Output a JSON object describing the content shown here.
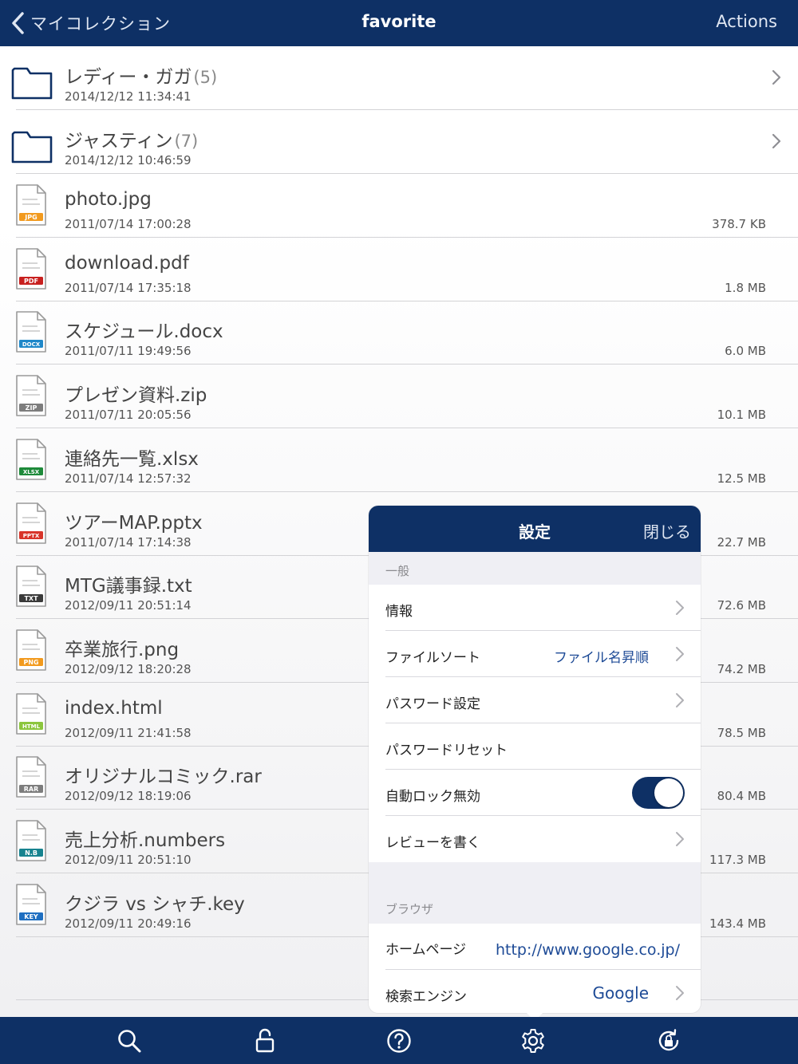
{
  "navbar": {
    "back_label": "マイコレクション",
    "title": "favorite",
    "actions_label": "Actions"
  },
  "folders": [
    {
      "name": "レディー・ガガ",
      "count": "(5)",
      "date": "2014/12/12 11:34:41"
    },
    {
      "name": "ジャスティン",
      "count": "(7)",
      "date": "2014/12/12 10:46:59"
    }
  ],
  "files": [
    {
      "name": "photo.jpg",
      "date": "2011/07/14 17:00:28",
      "size": "378.7 KB",
      "badge": "JPG",
      "color": "#f29a1e",
      "icon": "image-file-icon"
    },
    {
      "name": "download.pdf",
      "date": "2011/07/14 17:35:18",
      "size": "1.8 MB",
      "badge": "PDF",
      "color": "#c8201f",
      "icon": "pdf-file-icon"
    },
    {
      "name": "スケジュール.docx",
      "date": "2011/07/11 19:49:56",
      "size": "6.0 MB",
      "badge": "DOCX",
      "color": "#1f88c9",
      "icon": "word-file-icon"
    },
    {
      "name": "プレゼン資料.zip",
      "date": "2011/07/11 20:05:56",
      "size": "10.1 MB",
      "badge": "ZIP",
      "color": "#7d7d7d",
      "icon": "zip-file-icon"
    },
    {
      "name": "連絡先一覧.xlsx",
      "date": "2011/07/14 12:57:32",
      "size": "12.5 MB",
      "badge": "XLSX",
      "color": "#1e8a3a",
      "icon": "excel-file-icon"
    },
    {
      "name": "ツアーMAP.pptx",
      "date": "2011/07/14 17:14:38",
      "size": "22.7 MB",
      "badge": "PPTX",
      "color": "#d8352a",
      "icon": "powerpoint-file-icon"
    },
    {
      "name": "MTG議事録.txt",
      "date": "2012/09/11 20:51:14",
      "size": "72.6 MB",
      "badge": "TXT",
      "color": "#3a3a3a",
      "icon": "text-file-icon"
    },
    {
      "name": "卒業旅行.png",
      "date": "2012/09/12 18:20:28",
      "size": "74.2 MB",
      "badge": "PNG",
      "color": "#f29a1e",
      "icon": "image-file-icon"
    },
    {
      "name": "index.html",
      "date": "2012/09/11 21:41:58",
      "size": "78.5 MB",
      "badge": "HTML",
      "color": "#8cc63e",
      "icon": "html-file-icon"
    },
    {
      "name": "オリジナルコミック.rar",
      "date": "2012/09/12 18:19:06",
      "size": "80.4 MB",
      "badge": "RAR",
      "color": "#7d7d7d",
      "icon": "rar-file-icon"
    },
    {
      "name": "売上分析.numbers",
      "date": "2012/09/11 20:51:10",
      "size": "117.3 MB",
      "badge": "N.B",
      "color": "#17838f",
      "icon": "numbers-file-icon"
    },
    {
      "name": "クジラ vs シャチ.key",
      "date": "2012/09/11 20:49:16",
      "size": "143.4 MB",
      "badge": "KEY",
      "color": "#1f6fc1",
      "icon": "keynote-file-icon"
    }
  ],
  "settings": {
    "title": "設定",
    "close_label": "閉じる",
    "general_header": "一般",
    "info_label": "情報",
    "file_sort_label": "ファイルソート",
    "file_sort_value": "ファイル名昇順",
    "password_setting_label": "パスワード設定",
    "password_reset_label": "パスワードリセット",
    "auto_lock_label": "自動ロック無効",
    "auto_lock_on": true,
    "review_label": "レビューを書く",
    "browser_header": "ブラウザ",
    "homepage_label": "ホームページ",
    "homepage_value": "http://www.google.co.jp/",
    "search_engine_label": "検索エンジン",
    "search_engine_value": "Google"
  },
  "tabbar": {
    "tabs": [
      "search-icon",
      "lock-icon",
      "help-icon",
      "gear-icon",
      "lock-rotate-icon"
    ],
    "active": "gear-icon"
  },
  "colors": {
    "brand": "#0e3065",
    "accent_text": "#1d4a96"
  }
}
